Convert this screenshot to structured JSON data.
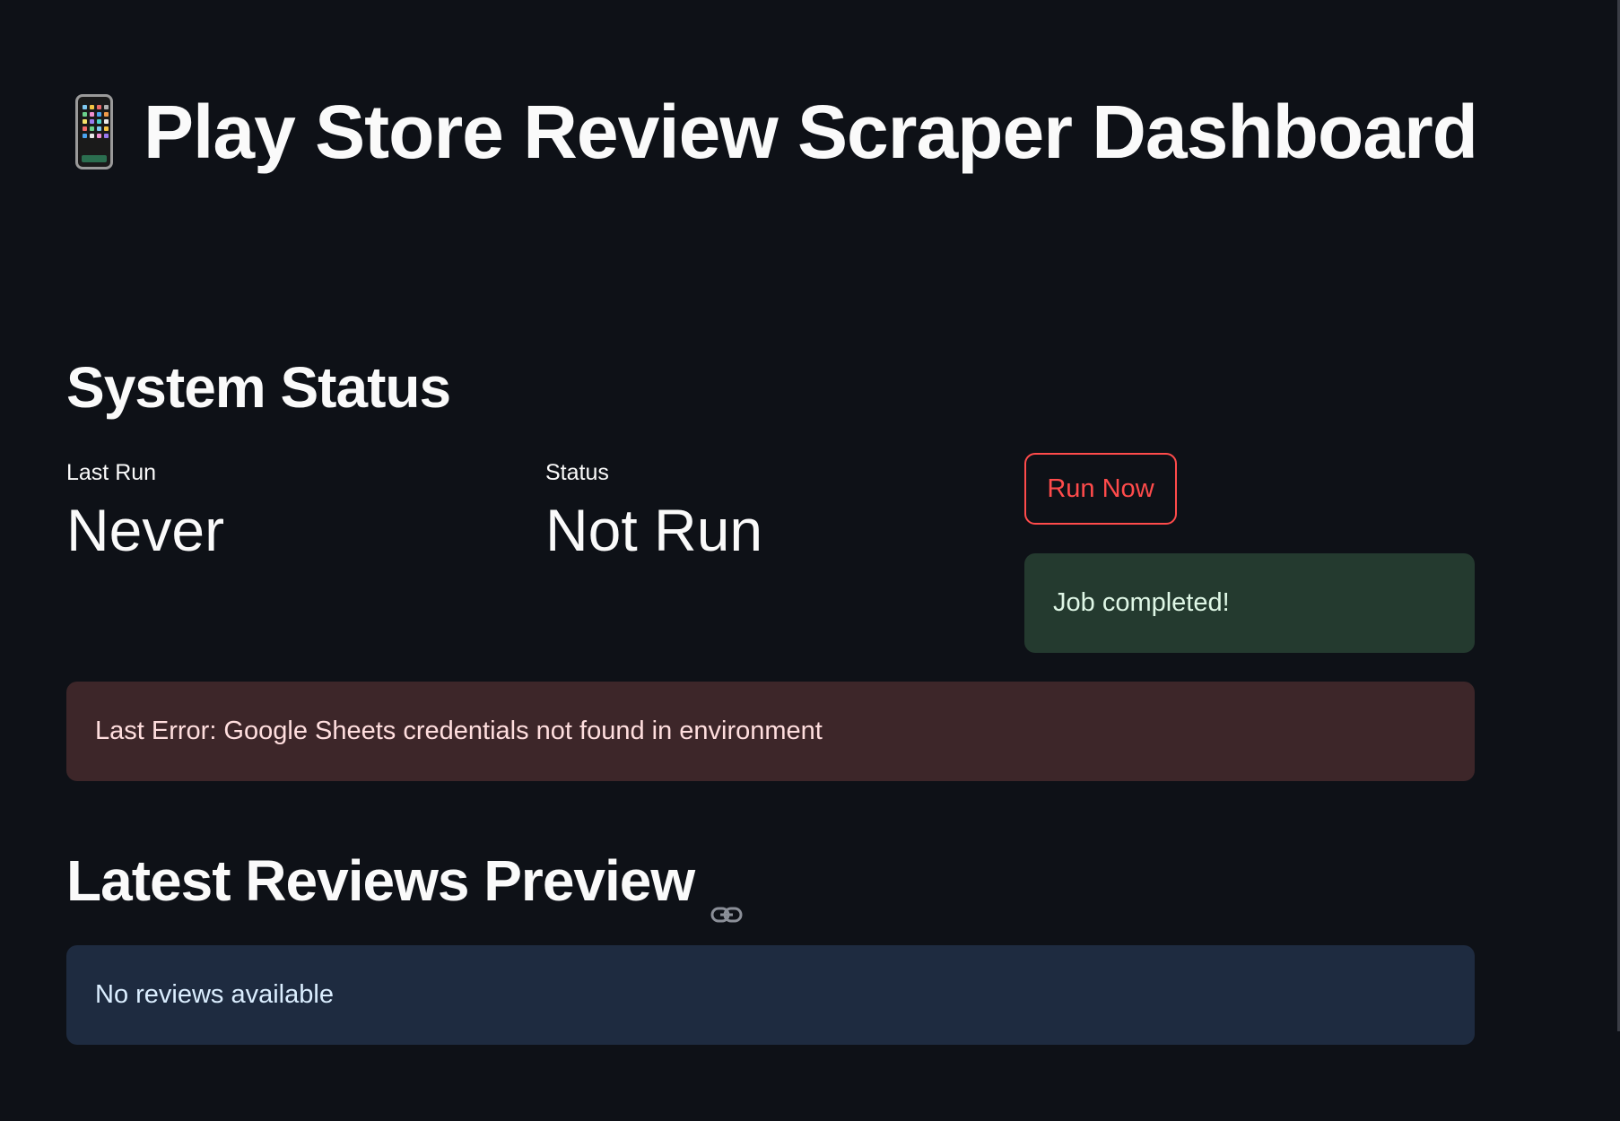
{
  "header": {
    "title": "Play Store Review Scraper Dashboard",
    "icon": "mobile-phone-icon"
  },
  "system_status": {
    "heading": "System Status",
    "last_run": {
      "label": "Last Run",
      "value": "Never"
    },
    "status": {
      "label": "Status",
      "value": "Not Run"
    },
    "run_button_label": "Run Now",
    "success_message": "Job completed!",
    "error_message": "Last Error: Google Sheets credentials not found in environment"
  },
  "reviews": {
    "heading": "Latest Reviews Preview",
    "empty_message": "No reviews available"
  },
  "colors": {
    "background": "#0e1117",
    "accent": "#ff4b4b",
    "success_bg": "#243a2f",
    "error_bg": "#3d2629",
    "info_bg": "#1e2b40"
  }
}
